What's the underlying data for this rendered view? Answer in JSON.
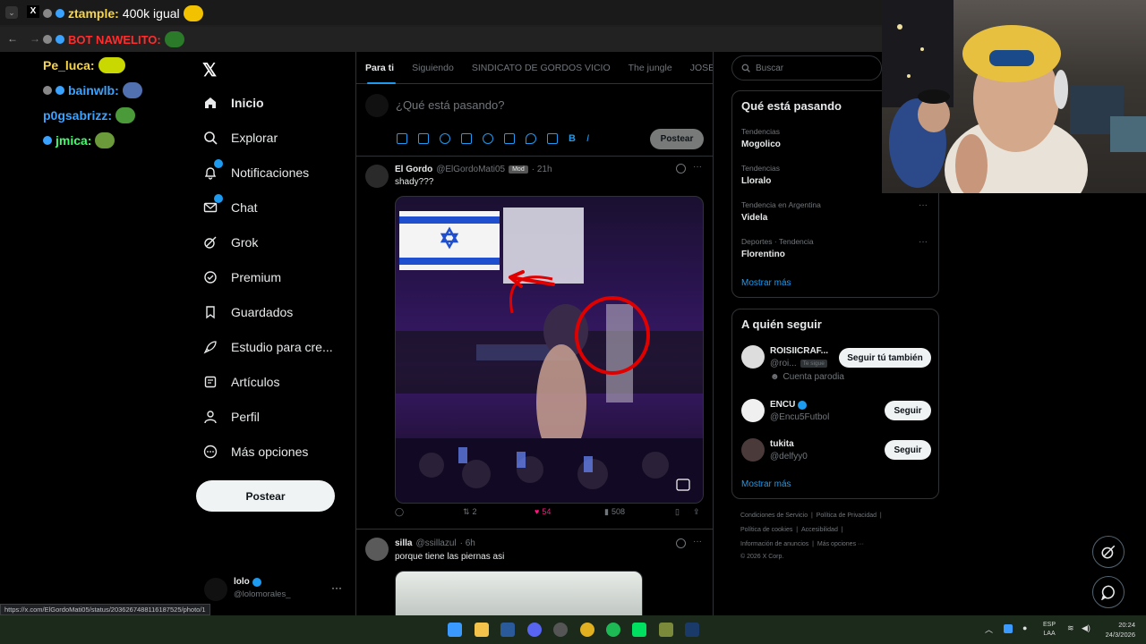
{
  "stream_chat": {
    "top_message": {
      "user": "ztample:",
      "text": "400k igual"
    },
    "second_message": {
      "user": "BOT NAWELITO:"
    },
    "messages": [
      {
        "user": "Pe_luca:"
      },
      {
        "user": "bainwlb:"
      },
      {
        "user": "p0gsabrizz:"
      },
      {
        "user": "jmica:"
      }
    ]
  },
  "nav": {
    "items": [
      {
        "label": "Inicio",
        "icon": "home-icon"
      },
      {
        "label": "Explorar",
        "icon": "search-icon"
      },
      {
        "label": "Notificaciones",
        "icon": "bell-icon"
      },
      {
        "label": "Chat",
        "icon": "mail-icon"
      },
      {
        "label": "Grok",
        "icon": "grok-icon"
      },
      {
        "label": "Premium",
        "icon": "premium-icon"
      },
      {
        "label": "Guardados",
        "icon": "bookmark-icon"
      },
      {
        "label": "Estudio para cre...",
        "icon": "rocket-icon"
      },
      {
        "label": "Artículos",
        "icon": "article-icon"
      },
      {
        "label": "Perfil",
        "icon": "person-icon"
      },
      {
        "label": "Más opciones",
        "icon": "more-circle-icon"
      }
    ],
    "post_button": "Postear",
    "account": {
      "name": "lolo",
      "handle": "@lolomorales_"
    }
  },
  "tabs": [
    "Para ti",
    "Siguiendo",
    "SINDICATO DE GORDOS VICIO",
    "The jungle",
    "JOSEO"
  ],
  "compose": {
    "placeholder": "¿Qué está pasando?",
    "post_label": "Postear"
  },
  "tweets": [
    {
      "name": "El Gordo",
      "handle": "@ElGordoMati05",
      "badge": "Mod",
      "time": "· 21h",
      "text": "shady???",
      "replies": "",
      "retweets": "2",
      "likes": "54",
      "views": "508"
    },
    {
      "name": "silla",
      "handle": "@ssillazul",
      "time": "· 6h",
      "text": "porque tiene las piernas asi"
    }
  ],
  "search": {
    "placeholder": "Buscar"
  },
  "trends": {
    "title": "Qué está pasando",
    "items": [
      {
        "meta": "Tendencias",
        "name": "Mogolico"
      },
      {
        "meta": "Tendencias",
        "name": "Lloralo"
      },
      {
        "meta": "Tendencia en Argentina",
        "name": "Videla"
      },
      {
        "meta": "Deportes · Tendencia",
        "name": "Florentino"
      }
    ],
    "more": "Mostrar más"
  },
  "follow": {
    "title": "A quién seguir",
    "items": [
      {
        "name": "ROISIICRAF...",
        "handle": "@roi...",
        "tag": "Te sigue",
        "note": "Cuenta parodia",
        "button": "Seguir tú también"
      },
      {
        "name": "ENCU",
        "handle": "@Encu5Futbol",
        "button": "Seguir"
      },
      {
        "name": "tukita",
        "handle": "@delfyy0",
        "button": "Seguir"
      }
    ],
    "more": "Mostrar más"
  },
  "footer": {
    "line1": [
      "Condiciones de Servicio",
      "Política de Privacidad"
    ],
    "line2": [
      "Política de cookies",
      "Accesibilidad"
    ],
    "line3": [
      "Información de anuncios",
      "Más opciones ···"
    ],
    "copyright": "© 2026 X Corp."
  },
  "status_url": "https://x.com/ElGordoMati05/status/2036267488116187525/photo/1",
  "taskbar": {
    "lang": "ESP",
    "lang2": "LAA",
    "time": "20:24",
    "date": "24/3/2026"
  },
  "colors": {
    "accent": "#1d9bf0",
    "like": "#f91880",
    "chat_gold": "#f7d54a",
    "chat_blue": "#3aa3ff",
    "chat_green": "#3dff6b"
  }
}
